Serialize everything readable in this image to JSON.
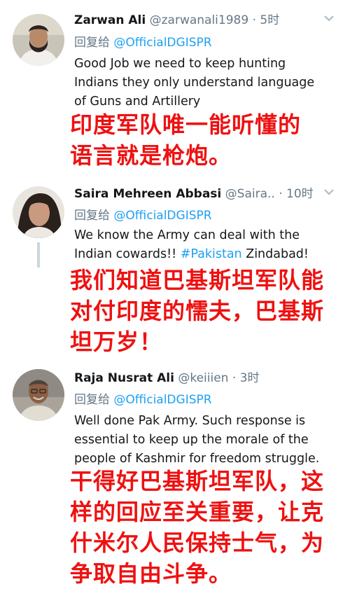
{
  "tweets": [
    {
      "display_name": "Zarwan Ali",
      "handle": "@zarwanali1989",
      "separator": "·",
      "time": "5时",
      "reply_prefix": "回复给",
      "reply_to": "@OfficialDGISPR",
      "text_lines": [
        "Good Job we need to keep hunting",
        "Indians they only understand language",
        "of Guns and Artillery"
      ],
      "overlay_lines": [
        "印度军队唯一能听懂的",
        "语言就是枪炮。"
      ]
    },
    {
      "display_name": "Saira Mehreen Abbasi",
      "handle": "@Saira..",
      "separator": "·",
      "time": "10时",
      "reply_prefix": "回复给",
      "reply_to": "@OfficialDGISPR",
      "text_line_1": "We know the Army can deal with the",
      "text_line_2_before": "Indian cowards!! ",
      "hashtag": "#Pakistan",
      "text_line_2_after": " Zindabad!",
      "overlay_lines": [
        "我们知道巴基斯坦军队能",
        "对付印度的懦夫，巴基斯",
        "坦万岁！"
      ]
    },
    {
      "display_name": "Raja Nusrat Ali",
      "handle": "@keiiien",
      "separator": "·",
      "time": "3时",
      "reply_prefix": "回复给",
      "reply_to": "@OfficialDGISPR",
      "text_lines": [
        "Well done Pak Army. Such response is",
        "essential to keep up the morale of the",
        "people of Kashmir for freedom struggle."
      ],
      "overlay_lines": [
        "干得好巴基斯坦军队，这",
        "样的回应至关重要，让克",
        "什米尔人民保持士气，为",
        "争取自由斗争。"
      ]
    }
  ],
  "icons": {
    "more": "chevron-down-icon"
  },
  "colors": {
    "name": "#14171a",
    "meta": "#657786",
    "link": "#1da1f2",
    "overlay_text": "#ee1111",
    "thread_line": "#ccd6dd"
  }
}
